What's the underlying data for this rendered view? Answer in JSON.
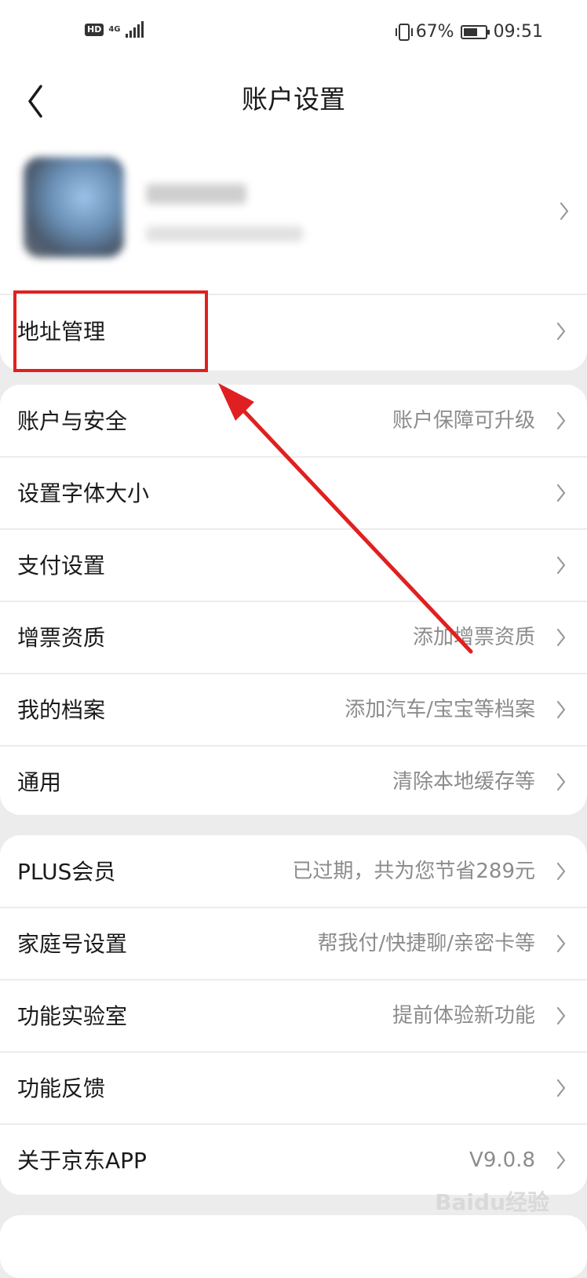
{
  "status_bar": {
    "hd": "HD",
    "network": "4G",
    "battery_percent": "67%",
    "battery_level": 0.67,
    "time": "09:51"
  },
  "nav": {
    "title": "账户设置",
    "back_icon": "chevron-left-icon"
  },
  "profile": {
    "avatar": "blurred-avatar",
    "nickname_blurred": true
  },
  "groups": [
    {
      "items": [
        {
          "label": "地址管理",
          "value": ""
        }
      ]
    },
    {
      "items": [
        {
          "label": "账户与安全",
          "value": "账户保障可升级"
        },
        {
          "label": "设置字体大小",
          "value": ""
        },
        {
          "label": "支付设置",
          "value": ""
        },
        {
          "label": "增票资质",
          "value": "添加增票资质"
        },
        {
          "label": "我的档案",
          "value": "添加汽车/宝宝等档案"
        },
        {
          "label": "通用",
          "value": "清除本地缓存等"
        }
      ]
    },
    {
      "items": [
        {
          "label": "PLUS会员",
          "value": "已过期，共为您节省289元"
        },
        {
          "label": "家庭号设置",
          "value": "帮我付/快捷聊/亲密卡等"
        },
        {
          "label": "功能实验室",
          "value": "提前体验新功能"
        },
        {
          "label": "功能反馈",
          "value": ""
        },
        {
          "label": "关于京东APP",
          "value": "V9.0.8"
        }
      ]
    }
  ],
  "annotation": {
    "color": "#e02020"
  },
  "watermark": "Baidu经验"
}
